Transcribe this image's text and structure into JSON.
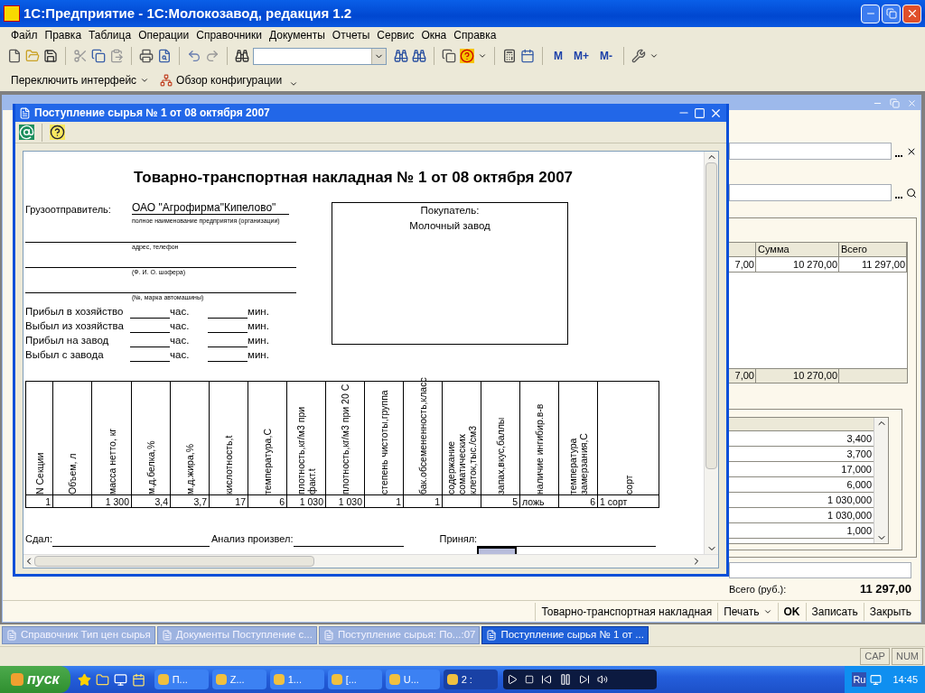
{
  "app_window": {
    "title": "1С:Предприятие - 1С:Молокозавод, редакция 1.2"
  },
  "menu": [
    "Файл",
    "Правка",
    "Таблица",
    "Операции",
    "Справочники",
    "Документы",
    "Отчеты",
    "Сервис",
    "Окна",
    "Справка"
  ],
  "memory_buttons": [
    "M",
    "M+",
    "M-"
  ],
  "panel_buttons": [
    {
      "label": "Переключить интерфейс",
      "dropdown": true
    },
    {
      "label": "Обзор конфигурации",
      "dropdown": false
    }
  ],
  "background_window": {
    "table": {
      "columns": [
        "",
        "Сумма",
        "Всего"
      ],
      "rows": [
        [
          "7,00",
          "10 270,00",
          "11 297,00"
        ]
      ],
      "totals": [
        "7,00",
        "10 270,00"
      ]
    },
    "values": [
      "3,400",
      "3,700",
      "17,000",
      "6,000",
      "1 030,000",
      "1 030,000",
      "1,000"
    ],
    "total_label": "Всего (руб.):",
    "total_value": "11 297,00",
    "buttons": [
      {
        "label": "Товарно-транспортная накладная",
        "dropdown": false,
        "default": false
      },
      {
        "label": "Печать",
        "dropdown": true,
        "default": false
      },
      {
        "label": "OK",
        "dropdown": false,
        "default": true
      },
      {
        "label": "Записать",
        "dropdown": false,
        "default": false
      },
      {
        "label": "Закрыть",
        "dropdown": false,
        "default": false
      }
    ]
  },
  "report_window": {
    "title": "Поступление сырья № 1 от 08 октября 2007",
    "document": {
      "heading": "Товарно-транспортная накладная № 1 от 08 октября 2007",
      "shipper_label": "Грузоотправитель:",
      "shipper": "ОАО \"Агрофирма\"Кипелово\"",
      "hints": [
        "полное наименование предприятия (организации)",
        "адрес, телефон",
        "(Ф. И. О. шофера)",
        "(№, марка автомашины)"
      ],
      "times": [
        {
          "label": "Прибыл в хозяйство",
          "hours": "час.",
          "minutes": "мин."
        },
        {
          "label": "Выбыл из хозяйства",
          "hours": "час.",
          "minutes": "мин."
        },
        {
          "label": "Прибыл на завод",
          "hours": "час.",
          "minutes": "мин."
        },
        {
          "label": "Выбыл с завода",
          "hours": "час.",
          "minutes": "мин."
        }
      ],
      "buyer_label": "Покупатель:",
      "buyer": "Молочный завод",
      "table": {
        "columns": [
          {
            "label": "N Секции",
            "kind": "number"
          },
          {
            "label": "Объем, л",
            "kind": "number"
          },
          {
            "label": "масса нетто, кг",
            "kind": "number"
          },
          {
            "label": "м.д.белка,%",
            "kind": "number"
          },
          {
            "label": "м.д.жира,%",
            "kind": "number"
          },
          {
            "label": "кислотность,t",
            "kind": "number"
          },
          {
            "label": "температура,С",
            "kind": "number"
          },
          {
            "label": "плотность,кг/м3 при факт.t",
            "kind": "number"
          },
          {
            "label": "плотность,кг/м3 при 20 С",
            "kind": "number"
          },
          {
            "label": "степень чистоты,группа",
            "kind": "number"
          },
          {
            "label": "бак.обсемененность,класс",
            "kind": "number"
          },
          {
            "label": "содержание соматических клеток,тыс./см3",
            "kind": "number"
          },
          {
            "label": "запах,вкус,баллы",
            "kind": "number"
          },
          {
            "label": "наличие ингибир.в-в",
            "kind": "text"
          },
          {
            "label": "температура замерзания,С",
            "kind": "number"
          },
          {
            "label": "сорт",
            "kind": "text"
          }
        ],
        "rows": [
          [
            "1",
            "",
            "1 300",
            "3,4",
            "3,7",
            "17",
            "6",
            "1 030",
            "1 030",
            "1",
            "1",
            "",
            "5",
            "ложь",
            "6",
            "1 сорт"
          ]
        ]
      },
      "signatures": [
        "Сдал:",
        "Анализ произвел:",
        "Принял:"
      ]
    }
  },
  "window_tabs": [
    {
      "label": "Справочник Тип цен сырья",
      "selected": false
    },
    {
      "label": "Документы Поступление с...",
      "selected": false
    },
    {
      "label": "Поступление сырья: По...:07",
      "selected": false
    },
    {
      "label": "Поступление сырья № 1 от ...",
      "selected": true
    }
  ],
  "status": [
    "CAP",
    "NUM"
  ],
  "taskbar": {
    "start": "пуск",
    "tasks": [
      {
        "label": "П...",
        "selected": false
      },
      {
        "label": "Z...",
        "selected": false
      },
      {
        "label": "1...",
        "selected": false
      },
      {
        "label": "[...",
        "selected": false
      },
      {
        "label": "U...",
        "selected": false
      },
      {
        "label": "2 :",
        "selected": true
      }
    ],
    "language": "Ru",
    "clock": "14:45"
  }
}
